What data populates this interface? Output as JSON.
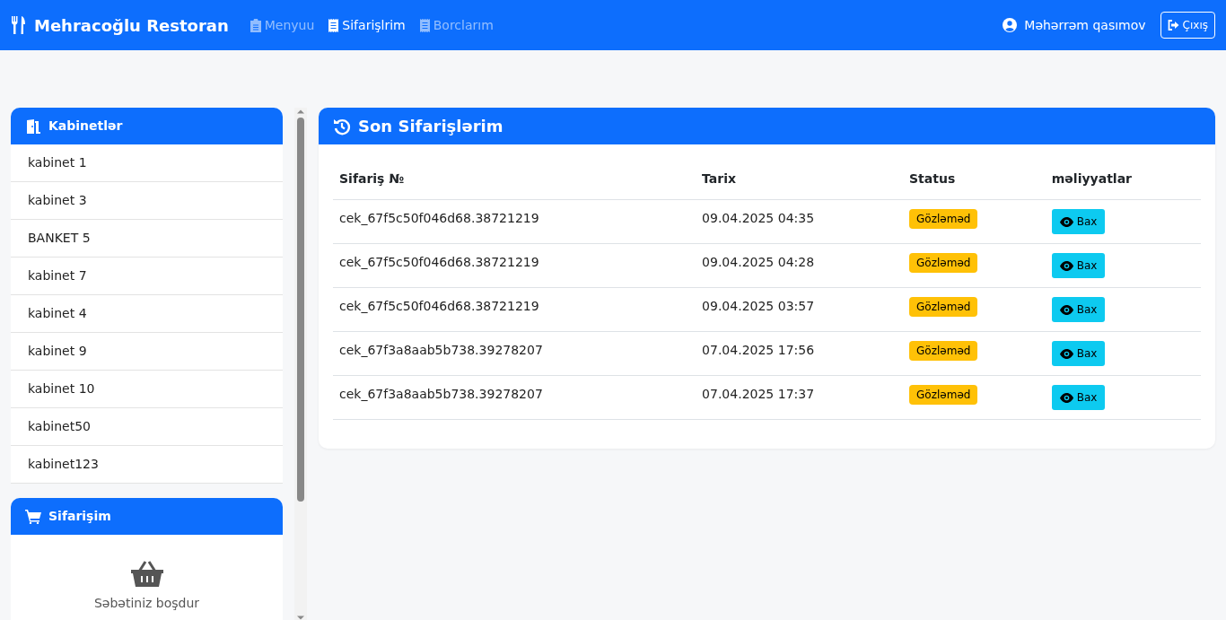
{
  "navbar": {
    "brand": "Mehracoğlu Restoran",
    "links": [
      {
        "label": "Menyuu",
        "selected": false
      },
      {
        "label": "Sifarişlrim",
        "selected": true
      },
      {
        "label": "Borclarım",
        "selected": false
      }
    ],
    "user": "Məhərrəm qasımov",
    "logout": "Çıxış"
  },
  "cabinets": {
    "title": "Kabinetlər",
    "items": [
      "kabinet 1",
      "kabinet 3",
      "BANKET 5",
      "kabinet 7",
      "kabinet 4",
      "kabinet 9",
      "kabinet 10",
      "kabinet50",
      "kabinet123"
    ]
  },
  "cart": {
    "title": "Sifarişim",
    "empty_text": "Səbətiniz boşdur"
  },
  "orders": {
    "title": "Son Sifarişlərim",
    "columns": [
      "Sifariş №",
      "Tarix",
      "Status",
      "məliyyatlar"
    ],
    "rows": [
      {
        "id": "cek_67f5c50f046d68.38721219",
        "date": "09.04.2025 04:35",
        "status": "Gözləməd",
        "action": "Bax"
      },
      {
        "id": "cek_67f5c50f046d68.38721219",
        "date": "09.04.2025 04:28",
        "status": "Gözləməd",
        "action": "Bax"
      },
      {
        "id": "cek_67f5c50f046d68.38721219",
        "date": "09.04.2025 03:57",
        "status": "Gözləməd",
        "action": "Bax"
      },
      {
        "id": "cek_67f3a8aab5b738.39278207",
        "date": "07.04.2025 17:56",
        "status": "Gözləməd",
        "action": "Bax"
      },
      {
        "id": "cek_67f3a8aab5b738.39278207",
        "date": "07.04.2025 17:37",
        "status": "Gözləməd",
        "action": "Bax"
      }
    ]
  }
}
